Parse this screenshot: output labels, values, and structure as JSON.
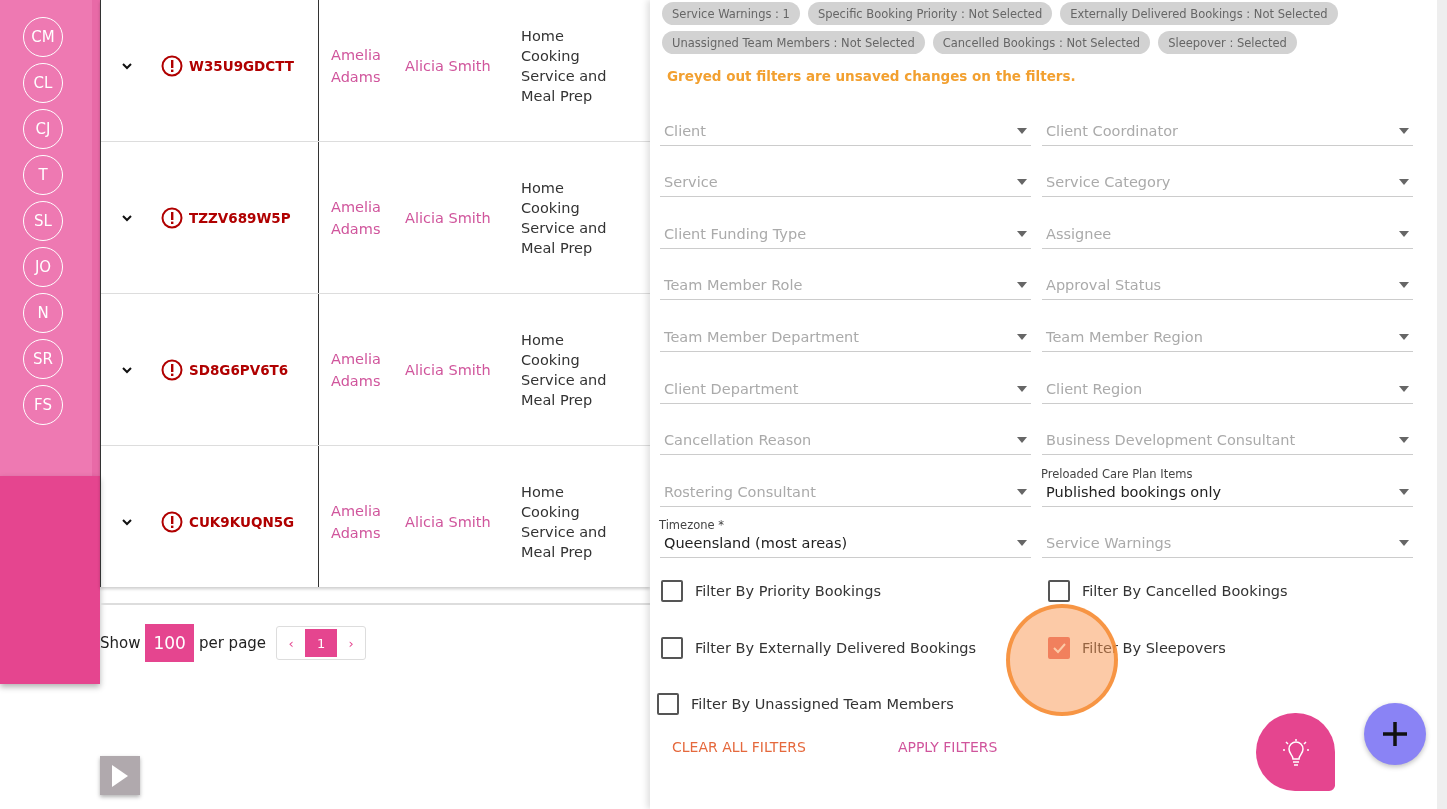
{
  "sidebar": {
    "avatars": [
      "CM",
      "CL",
      "CJ",
      "T",
      "SL",
      "JO",
      "N",
      "SR",
      "FS"
    ]
  },
  "table": {
    "rows": [
      {
        "id": "W35U9GDCTT",
        "client": "Amelia Adams",
        "coordinator": "Alicia Smith",
        "service": "Home Cooking Service and Meal Prep"
      },
      {
        "id": "TZZV689W5P",
        "client": "Amelia Adams",
        "coordinator": "Alicia Smith",
        "service": "Home Cooking Service and Meal Prep"
      },
      {
        "id": "SD8G6PV6T6",
        "client": "Amelia Adams",
        "coordinator": "Alicia Smith",
        "service": "Home Cooking Service and Meal Prep"
      },
      {
        "id": "CUK9KUQN5G",
        "client": "Amelia Adams",
        "coordinator": "Alicia Smith",
        "service": "Home Cooking Service and Meal Prep"
      }
    ]
  },
  "pagination": {
    "show_label": "Show",
    "per_page": "100",
    "per_page_label": "per page",
    "prev": "‹",
    "pages": [
      {
        "label": "1",
        "selected": true
      }
    ],
    "next": "›"
  },
  "filter_panel": {
    "chips": [
      {
        "label": "Service Warnings : 1"
      },
      {
        "label": "Specific Booking Priority : Not Selected"
      },
      {
        "label": "Externally Delivered Bookings : Not Selected"
      },
      {
        "label": "Unassigned Team Members : Not Selected"
      },
      {
        "label": "Cancelled Bookings : Not Selected"
      },
      {
        "label": "Sleepover : Selected"
      }
    ],
    "notice": "Greyed out filters are unsaved changes on the filters.",
    "field_rows": [
      [
        {
          "placeholder": "Client"
        },
        {
          "placeholder": "Client Coordinator"
        }
      ],
      [
        {
          "placeholder": "Service"
        },
        {
          "placeholder": "Service Category"
        }
      ],
      [
        {
          "placeholder": "Client Funding Type"
        },
        {
          "placeholder": "Assignee"
        }
      ],
      [
        {
          "placeholder": "Team Member Role"
        },
        {
          "placeholder": "Approval Status"
        }
      ],
      [
        {
          "placeholder": "Team Member Department"
        },
        {
          "placeholder": "Team Member Region"
        }
      ],
      [
        {
          "placeholder": "Client Department"
        },
        {
          "placeholder": "Client Region"
        }
      ],
      [
        {
          "placeholder": "Cancellation Reason"
        },
        {
          "placeholder": "Business Development Consultant"
        }
      ],
      [
        {
          "placeholder": "Rostering Consultant"
        },
        {
          "label": "Preloaded Care Plan Items",
          "value": "Published bookings only"
        }
      ],
      [
        {
          "label": "Timezone *",
          "value": "Queensland (most areas)"
        },
        {
          "placeholder": "Service Warnings"
        }
      ]
    ],
    "checkboxes": [
      {
        "label": "Filter By Priority Bookings",
        "checked": false
      },
      {
        "label": "Filter By Cancelled Bookings",
        "checked": false
      },
      {
        "label": "Filter By Externally Delivered Bookings",
        "checked": false
      },
      {
        "label": "Filter By Sleepovers",
        "checked": true
      },
      {
        "label": "Filter By Unassigned Team Members",
        "checked": false
      }
    ],
    "clear_button": "CLEAR ALL FILTERS",
    "apply_button": "APPLY FILTERS"
  }
}
